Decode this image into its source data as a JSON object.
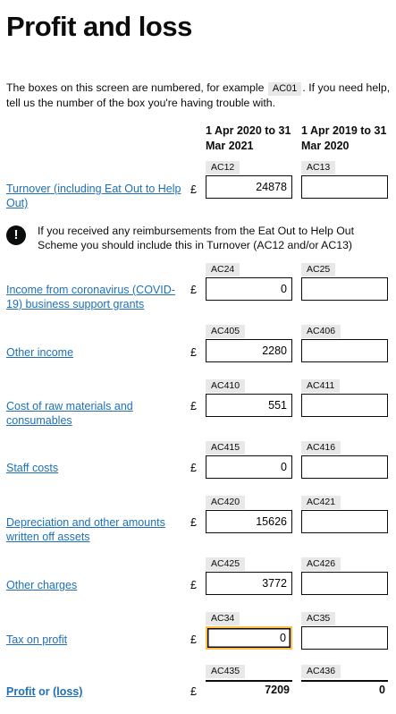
{
  "page": {
    "title": "Profit and loss",
    "intro_before": "The boxes on this screen are numbered, for example ",
    "intro_example_box": "AC01",
    "intro_after": ". If you need help, tell us the number of the box you're having trouble with."
  },
  "columns": {
    "current": "1 Apr 2020 to 31 Mar 2021",
    "previous": "1 Apr 2019 to 31 Mar 2020"
  },
  "currency_symbol": "£",
  "notice": {
    "icon": "warning-icon",
    "icon_glyph": "!",
    "text": "If you received any reimbursements from the Eat Out to Help Out Scheme you should include this in Turnover (AC12 and/or AC13)"
  },
  "rows": [
    {
      "label": "Turnover (including Eat Out to Help Out)",
      "code_current": "AC12",
      "code_previous": "AC13",
      "value_current": "24878",
      "value_previous": ""
    },
    {
      "label": "Income from coronavirus (COVID-19) business support grants",
      "code_current": "AC24",
      "code_previous": "AC25",
      "value_current": "0",
      "value_previous": ""
    },
    {
      "label": "Other income",
      "code_current": "AC405",
      "code_previous": "AC406",
      "value_current": "2280",
      "value_previous": ""
    },
    {
      "label": "Cost of raw materials and consumables",
      "code_current": "AC410",
      "code_previous": "AC411",
      "value_current": "551",
      "value_previous": ""
    },
    {
      "label": "Staff costs",
      "code_current": "AC415",
      "code_previous": "AC416",
      "value_current": "0",
      "value_previous": ""
    },
    {
      "label": "Depreciation and other amounts written off assets",
      "code_current": "AC420",
      "code_previous": "AC421",
      "value_current": "15626",
      "value_previous": ""
    },
    {
      "label": "Other charges",
      "code_current": "AC425",
      "code_previous": "AC426",
      "value_current": "3772",
      "value_previous": ""
    },
    {
      "label": "Tax on profit",
      "code_current": "AC34",
      "code_previous": "AC35",
      "value_current": "0",
      "value_previous": ""
    }
  ],
  "total": {
    "label_profit": "Profit",
    "label_or": " or ",
    "label_loss": "(loss)",
    "code_current": "AC435",
    "code_previous": "AC436",
    "value_current": "7209",
    "value_previous": "0"
  },
  "colors": {
    "link": "#1d70b8",
    "text": "#0b0c0c",
    "focus": "#ffbf47",
    "tag_bg": "#e8e8e8"
  }
}
